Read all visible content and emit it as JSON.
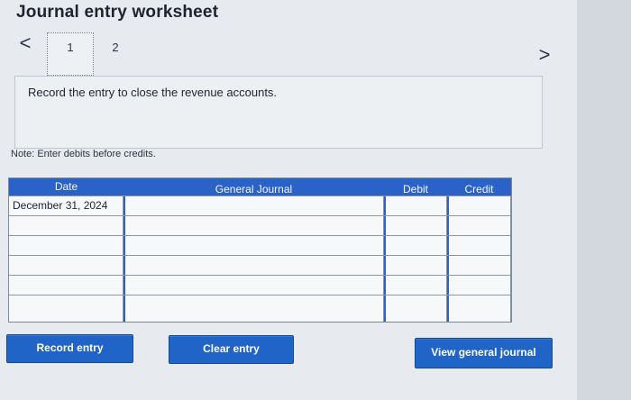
{
  "header": {
    "title": "Journal entry worksheet"
  },
  "navigation": {
    "prev_icon": "<",
    "next_icon": ">",
    "steps": [
      {
        "label": "1",
        "selected": true
      },
      {
        "label": "2",
        "selected": false
      }
    ]
  },
  "prompt": {
    "text": "Record the entry to close the revenue accounts."
  },
  "note": {
    "text": "Note: Enter debits before credits."
  },
  "table": {
    "headers": {
      "date": "Date",
      "general_journal": "General Journal",
      "debit": "Debit",
      "credit": "Credit"
    },
    "rows": [
      {
        "date": "December 31, 2024",
        "general_journal": "",
        "debit": "",
        "credit": ""
      },
      {
        "date": "",
        "general_journal": "",
        "debit": "",
        "credit": ""
      },
      {
        "date": "",
        "general_journal": "",
        "debit": "",
        "credit": ""
      },
      {
        "date": "",
        "general_journal": "",
        "debit": "",
        "credit": ""
      },
      {
        "date": "",
        "general_journal": "",
        "debit": "",
        "credit": ""
      },
      {
        "date": "",
        "general_journal": "",
        "debit": "",
        "credit": ""
      }
    ]
  },
  "buttons": {
    "record_entry": "Record entry",
    "clear_entry": "Clear entry",
    "view_general_journal": "View general journal"
  },
  "colors": {
    "accent": "#1f64c6",
    "header_blue": "#2b62c7",
    "background": "#e7eaee"
  },
  "icons": {
    "prev": "chevron-left-icon",
    "next": "chevron-right-icon"
  }
}
